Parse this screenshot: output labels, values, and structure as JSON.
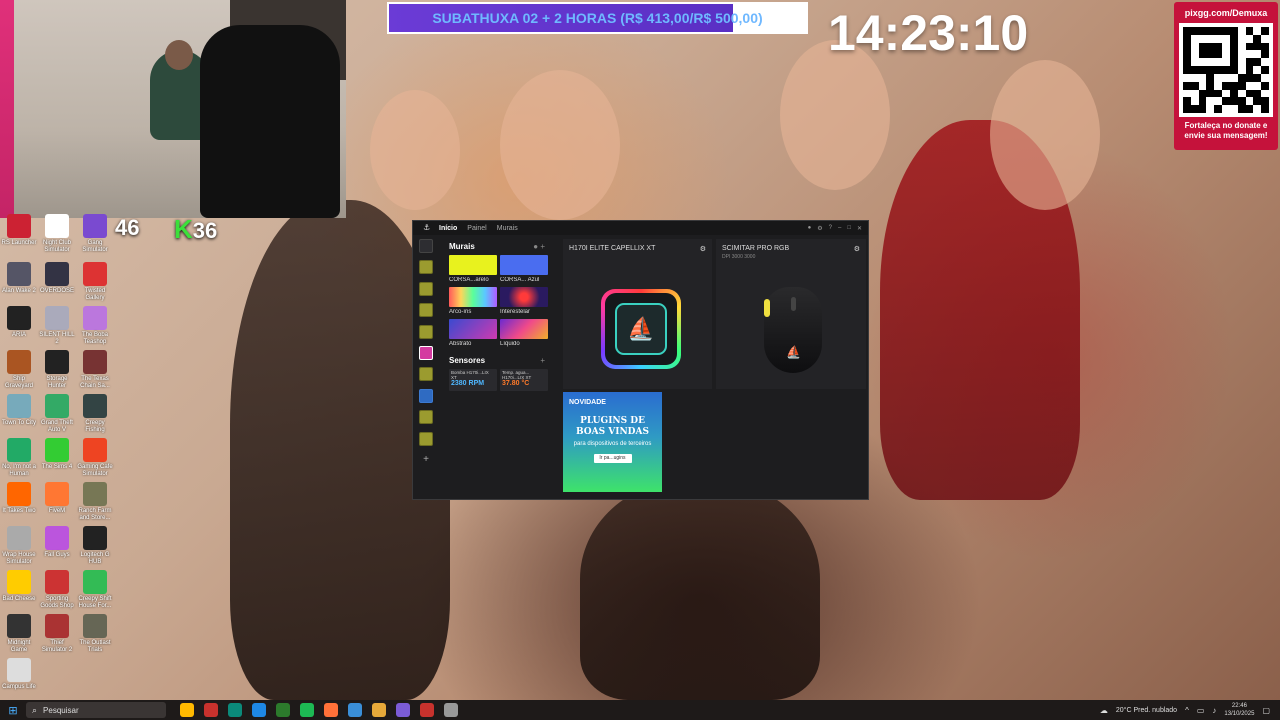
{
  "overlay": {
    "subathon_text": "SUBATHUXA 02 + 2 HORAS (R$ 413,00/R$ 500,00)",
    "subathon_progress": 0.826,
    "clock": "14:23:10",
    "qr_url": "pixgg.com/Demuxa",
    "qr_message_line1": "Fortaleça no donate e",
    "qr_message_line2": "envie sua mensagem!"
  },
  "counters": {
    "left": "46",
    "right": "36",
    "right_prefix": "K"
  },
  "desktop_icons": [
    {
      "label": "RS Launcher",
      "color": "#c23"
    },
    {
      "label": "Night Club Simulator",
      "color": "#fff"
    },
    {
      "label": "Gang Simulator",
      "color": "#7a4ad0"
    },
    {
      "label": "Alan Wake 2",
      "color": "#556"
    },
    {
      "label": "OVERDOSE",
      "color": "#334"
    },
    {
      "label": "Twisted Gallery",
      "color": "#d33"
    },
    {
      "label": "ARIA",
      "color": "#222"
    },
    {
      "label": "SILENT HILL 2",
      "color": "#aab"
    },
    {
      "label": "The Boba Teashop",
      "color": "#b7d"
    },
    {
      "label": "Ship Graveyard",
      "color": "#a52"
    },
    {
      "label": "Storage Hunter",
      "color": "#222"
    },
    {
      "label": "The Texas Chain Sa...",
      "color": "#733"
    },
    {
      "label": "Town To City",
      "color": "#7ab"
    },
    {
      "label": "Grand Theft Auto V",
      "color": "#3a6"
    },
    {
      "label": "Creepy Fishing",
      "color": "#344"
    },
    {
      "label": "No, I'm not a Human",
      "color": "#2a6"
    },
    {
      "label": "The Sims 4",
      "color": "#3c3"
    },
    {
      "label": "Gaming Cafe Simulator",
      "color": "#e42"
    },
    {
      "label": "It Takes Two",
      "color": "#f60"
    },
    {
      "label": "FiveM",
      "color": "#f73"
    },
    {
      "label": "Ranch Farm and Store...",
      "color": "#775"
    },
    {
      "label": "Wrap House Simulator",
      "color": "#aaa"
    },
    {
      "label": "Fall Guys",
      "color": "#b5d"
    },
    {
      "label": "Logitech G HUB",
      "color": "#222"
    },
    {
      "label": "Bad Cheese",
      "color": "#fc0"
    },
    {
      "label": "Sporting Goods Shop",
      "color": "#c33"
    },
    {
      "label": "Creepy Shift House For...",
      "color": "#3b5"
    },
    {
      "label": "Midnight Game",
      "color": "#333"
    },
    {
      "label": "Thief Simulator 2",
      "color": "#a33"
    },
    {
      "label": "The Outlast Trials",
      "color": "#665"
    },
    {
      "label": "Campus Life",
      "color": "#ddd"
    }
  ],
  "icue": {
    "tabs": [
      "Início",
      "Painel",
      "Murais"
    ],
    "active_tab": "Início",
    "murals_title": "Murais",
    "murals": [
      {
        "name": "CORSA...arelo",
        "color": "#e8f21e"
      },
      {
        "name": "CORSA... Azul",
        "color": "#4a6df0"
      },
      {
        "name": "Arco-íris",
        "color": "linear-gradient(90deg,#ff5a5a,#ffd55a,#5aff9a,#5ac8ff,#b05aff)"
      },
      {
        "name": "Interestelar",
        "color": "radial-gradient(circle,#ff3a3a 15%,#2a1a60 60%)"
      },
      {
        "name": "Abstrato",
        "color": "linear-gradient(135deg,#3a4ad0,#d03ab0)"
      },
      {
        "name": "Líquido",
        "color": "linear-gradient(135deg,#6a2ad0,#f04a8a,#f0b02a)"
      }
    ],
    "sensors_title": "Sensores",
    "sensors": [
      {
        "name": "Bomba H170i...LIX XT",
        "value": "2380 RPM"
      },
      {
        "name": "Temp. agua... H170i...LIX XT",
        "value": "37.80 °C"
      }
    ],
    "device1": {
      "name": "H170I ELITE CAPELLIX XT"
    },
    "device2": {
      "name": "SCIMITAR PRO RGB",
      "sub": "DPI 3000 3000"
    },
    "promo": {
      "badge": "NOVIDADE",
      "headline": "PLUGINS DE BOAS VINDAS",
      "desc": "para dispositivos de terceiros",
      "button": "Ir pa...ugins"
    }
  },
  "taskbar": {
    "search_placeholder": "Pesquisar",
    "weather": "20°C Pred. nublado",
    "time": "22:46",
    "date": "13/10/2025",
    "apps": [
      "#ffb900",
      "#c8322d",
      "#0b8a7a",
      "#1e88e5",
      "#2c7a2c",
      "#1db954",
      "#ff7139",
      "#3a8fd8",
      "#e5a93a",
      "#7b5cd6",
      "#c8322d",
      "#999"
    ]
  }
}
